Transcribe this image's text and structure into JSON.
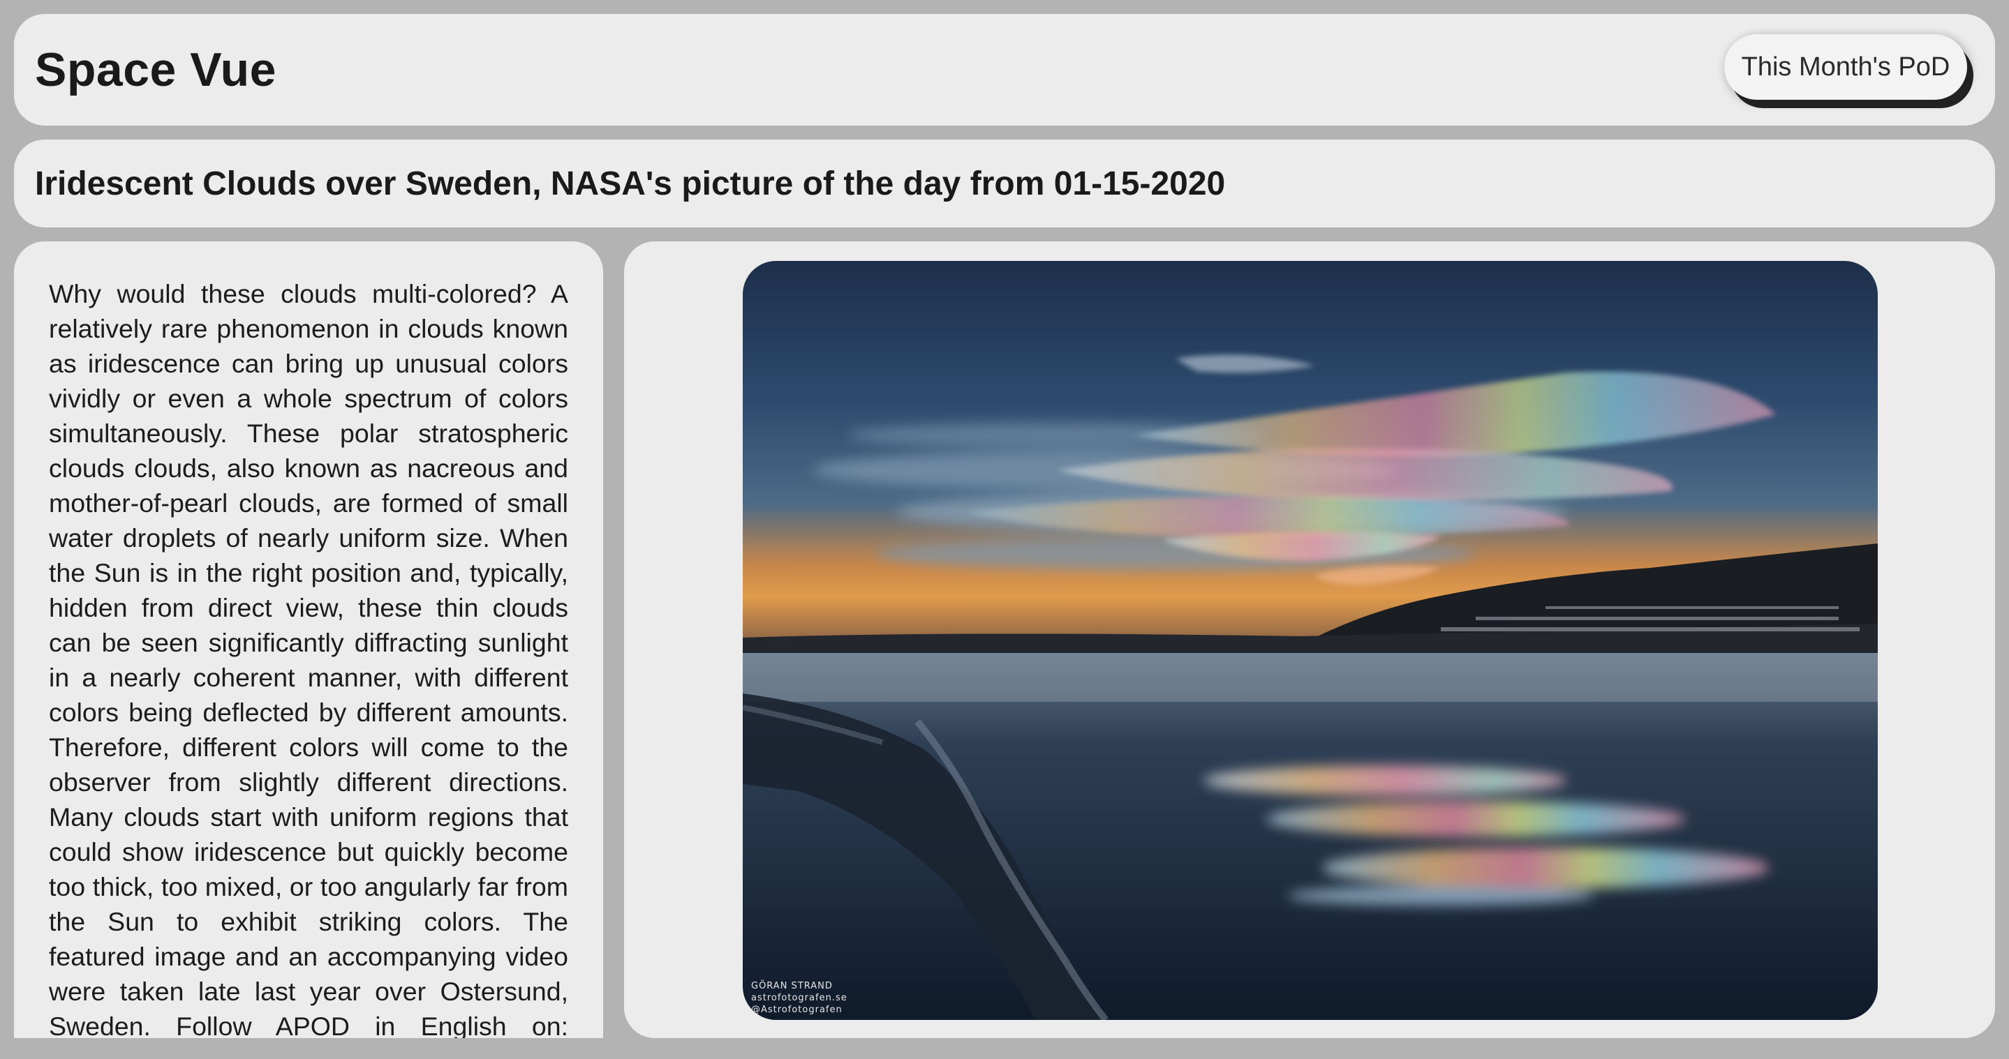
{
  "header": {
    "app_title": "Space Vue",
    "pod_button_label": "This Month's PoD"
  },
  "pod": {
    "title": "Iridescent Clouds over Sweden, NASA's picture of the day from 01-15-2020",
    "explanation": "Why would these clouds multi-colored? A relatively rare phenomenon in clouds known as iridescence can bring up unusual colors vividly or even a whole spectrum of colors simultaneously. These polar stratospheric clouds clouds, also known as nacreous and mother-of-pearl clouds, are formed of small water droplets of nearly uniform size. When the Sun is in the right position and, typically, hidden from direct view, these thin clouds can be seen significantly diffracting sunlight in a nearly coherent manner, with different colors being deflected by different amounts. Therefore, different colors will come to the observer from slightly different directions. Many clouds start with uniform regions that could show iridescence but quickly become too thick, too mixed, or too angularly far from the Sun to exhibit striking colors. The featured image and an accompanying video were taken late last year over Ostersund, Sweden. Follow APOD in English on: Instagram,",
    "image_credit": {
      "line1": "GÖRAN STRAND",
      "line2": "astrofotografen.se",
      "line3": "@Astrofotografen"
    }
  },
  "colors": {
    "page_background": "#b3b3b3",
    "panel_background": "#ececec",
    "button_shadow": "#222222"
  }
}
